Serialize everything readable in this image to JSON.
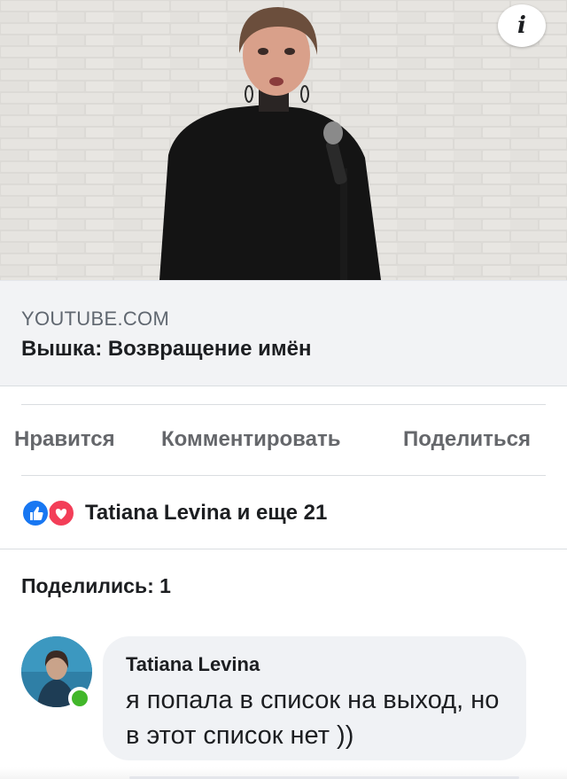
{
  "preview": {
    "domain": "YOUTUBE.COM",
    "title": "Вышка: Возвращение имён",
    "info_icon": "info-icon",
    "info_glyph": "i"
  },
  "actions": {
    "like": "Нравится",
    "comment": "Комментировать",
    "share": "Поделиться"
  },
  "reactions": {
    "icons": [
      "like-icon",
      "love-icon"
    ],
    "like_color": "#1877f2",
    "love_color": "#f33e58",
    "text": "Tatiana Levina и еще 21"
  },
  "shares": {
    "text": "Поделились: 1"
  },
  "comment": {
    "author": "Tatiana Levina",
    "text": "я попала в список на выход, но в этот список нет ))",
    "online": true,
    "online_color": "#42b72a"
  }
}
